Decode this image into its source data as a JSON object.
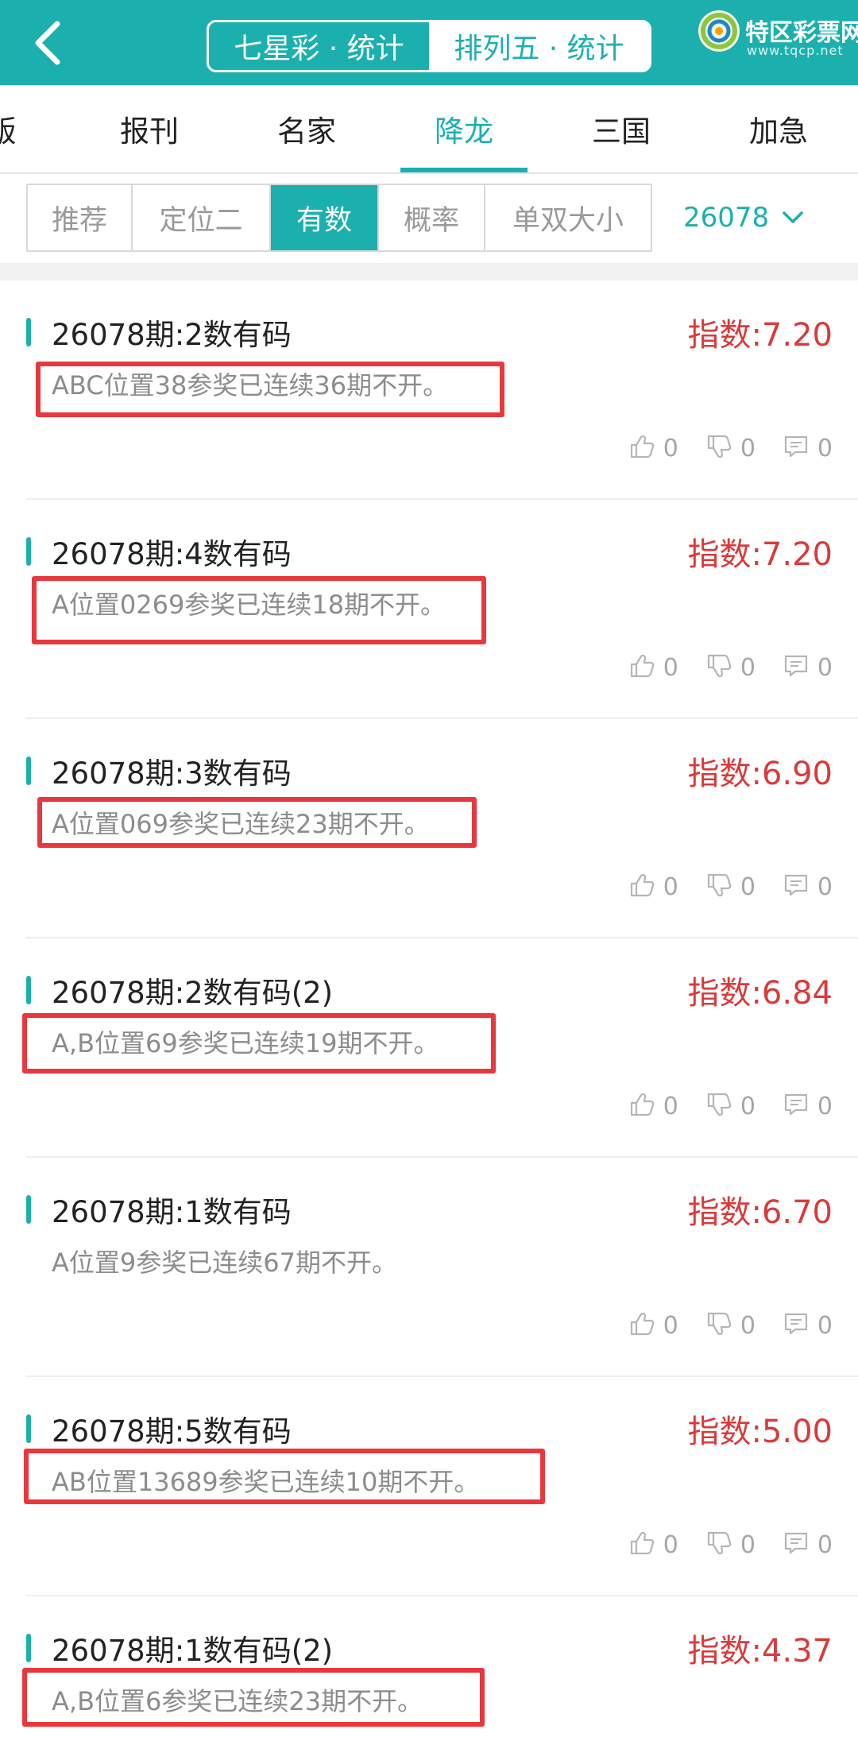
{
  "header": {
    "segments": [
      {
        "label": "七星彩 · 统计",
        "active": false
      },
      {
        "label": "排列五 · 统计",
        "active": true
      }
    ],
    "logo_text": "特区彩票网",
    "logo_sub": "www.tqcp.net"
  },
  "category_tabs": [
    {
      "label": "版",
      "active": false
    },
    {
      "label": "报刊",
      "active": false
    },
    {
      "label": "名家",
      "active": false
    },
    {
      "label": "降龙",
      "active": true
    },
    {
      "label": "三国",
      "active": false
    },
    {
      "label": "加急",
      "active": false
    }
  ],
  "filters": [
    {
      "label": "推荐",
      "active": false
    },
    {
      "label": "定位二",
      "active": false
    },
    {
      "label": "有数",
      "active": true
    },
    {
      "label": "概率",
      "active": false
    },
    {
      "label": "单双大小",
      "active": false
    }
  ],
  "issue_select": "26078",
  "cards": [
    {
      "title": "26078期:2数有码",
      "index": "指数:7.20",
      "desc": "ABC位置38参奖已连续36期不开。",
      "highlighted": true,
      "likes": "0",
      "dislikes": "0",
      "comments": "0"
    },
    {
      "title": "26078期:4数有码",
      "index": "指数:7.20",
      "desc": "A位置0269参奖已连续18期不开。",
      "highlighted": true,
      "likes": "0",
      "dislikes": "0",
      "comments": "0"
    },
    {
      "title": "26078期:3数有码",
      "index": "指数:6.90",
      "desc": "A位置069参奖已连续23期不开。",
      "highlighted": true,
      "likes": "0",
      "dislikes": "0",
      "comments": "0"
    },
    {
      "title": "26078期:2数有码(2)",
      "index": "指数:6.84",
      "desc": "A,B位置69参奖已连续19期不开。",
      "highlighted": true,
      "likes": "0",
      "dislikes": "0",
      "comments": "0"
    },
    {
      "title": "26078期:1数有码",
      "index": "指数:6.70",
      "desc": "A位置9参奖已连续67期不开。",
      "highlighted": false,
      "likes": "0",
      "dislikes": "0",
      "comments": "0"
    },
    {
      "title": "26078期:5数有码",
      "index": "指数:5.00",
      "desc": "AB位置13689参奖已连续10期不开。",
      "highlighted": true,
      "likes": "0",
      "dislikes": "0",
      "comments": "0"
    },
    {
      "title": "26078期:1数有码(2)",
      "index": "指数:4.37",
      "desc": "A,B位置6参奖已连续23期不开。",
      "highlighted": true,
      "likes": "0",
      "dislikes": "0",
      "comments": "0"
    }
  ],
  "colors": {
    "accent": "#1bb0ae",
    "index_red": "#d93a3a",
    "highlight_red": "#e8383d"
  }
}
